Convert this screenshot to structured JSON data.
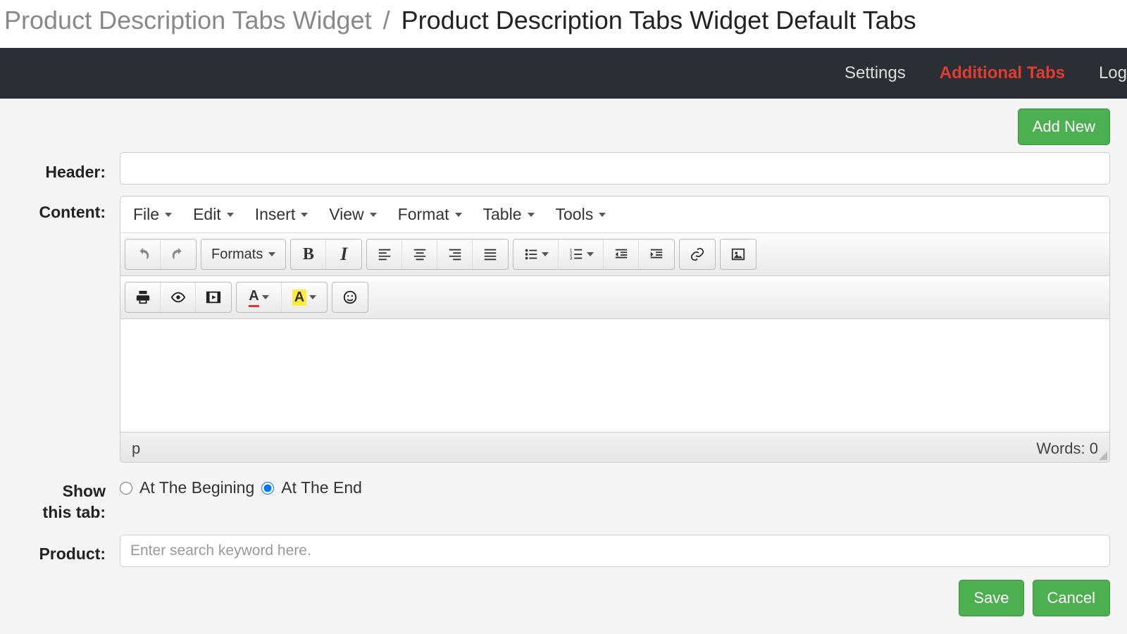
{
  "breadcrumb": {
    "link": "Product Description Tabs Widget",
    "sep": "/",
    "current": "Product Description Tabs Widget Default Tabs"
  },
  "nav": {
    "settings": "Settings",
    "additional": "Additional Tabs",
    "log": "Log"
  },
  "buttons": {
    "add_new": "Add New",
    "save": "Save",
    "cancel": "Cancel"
  },
  "labels": {
    "header": "Header:",
    "content": "Content:",
    "show_tab_1": "Show",
    "show_tab_2": "this tab:",
    "product": "Product:"
  },
  "editor": {
    "menus": {
      "file": "File",
      "edit": "Edit",
      "insert": "Insert",
      "view": "View",
      "format": "Format",
      "table": "Table",
      "tools": "Tools"
    },
    "formats": "Formats",
    "status_path": "p",
    "words_label": "Words: 0"
  },
  "radios": {
    "begin": "At The Begining",
    "end": "At The End"
  },
  "product_placeholder": "Enter search keyword here.",
  "header_value": ""
}
